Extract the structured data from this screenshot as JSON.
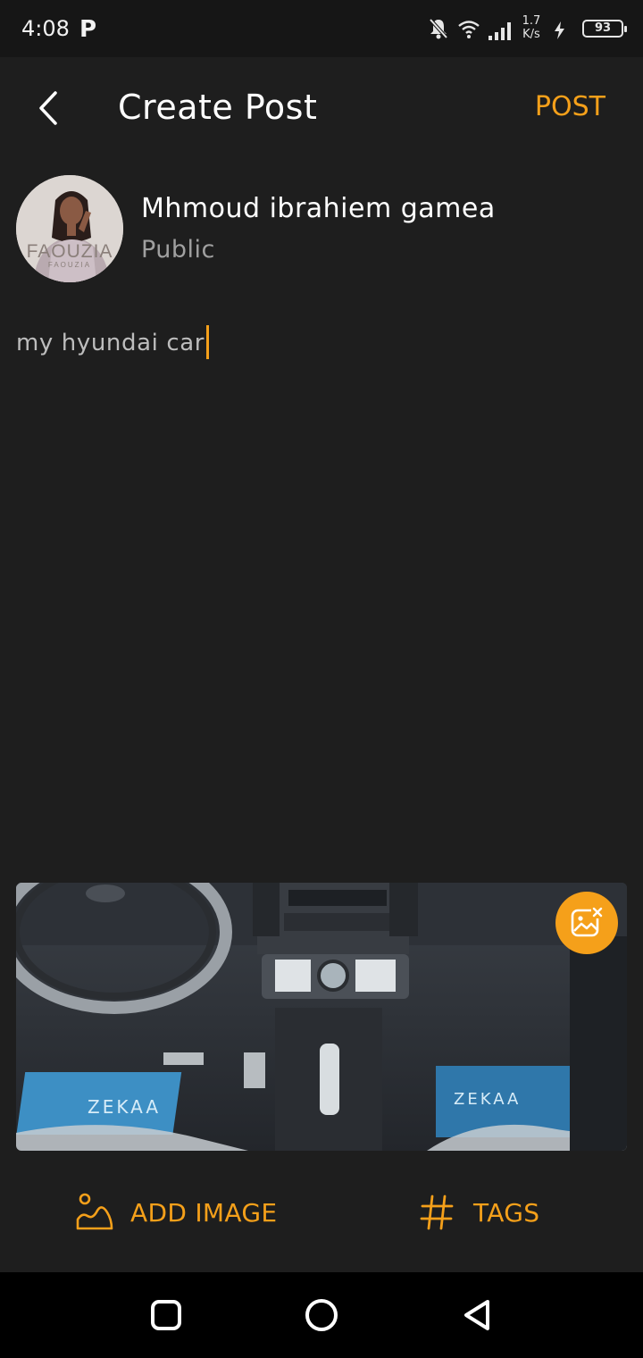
{
  "status_bar": {
    "time": "4:08",
    "app_badge": "P",
    "net_speed_value": "1.7",
    "net_speed_unit": "K/s",
    "battery": "93"
  },
  "header": {
    "title": "Create Post",
    "post_label": "POST"
  },
  "user": {
    "name": "Mhmoud ibrahiem gamea",
    "privacy": "Public",
    "avatar_text": "FAOUZIA",
    "avatar_subtext": "FAOUZIA"
  },
  "post": {
    "text": "my hyundai car"
  },
  "preview": {
    "mat_text_left": "ZEKAA",
    "mat_text_right": "ZEKAA"
  },
  "actions": {
    "add_image_label": "ADD IMAGE",
    "tags_label": "TAGS"
  },
  "colors": {
    "accent": "#f5a01a",
    "background": "#1e1e1e",
    "status_bar": "#161616",
    "nav_bar": "#000000"
  },
  "icons": {
    "back": "chevron-left-icon",
    "remove_image": "image-remove-icon",
    "add_image": "landscape-image-icon",
    "tags": "hashtag-icon",
    "nav_recents": "square-icon",
    "nav_home": "circle-icon",
    "nav_back": "triangle-back-icon"
  }
}
